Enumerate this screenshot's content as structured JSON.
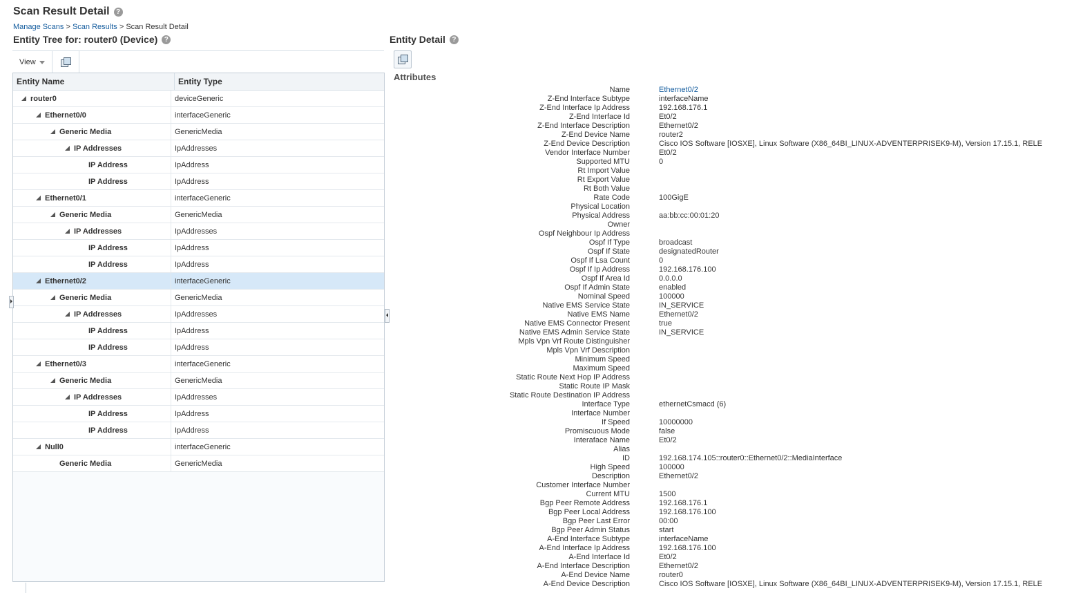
{
  "page": {
    "title": "Scan Result Detail",
    "help_glyph": "?"
  },
  "breadcrumb": {
    "items": [
      "Manage Scans",
      "Scan Results"
    ],
    "separator": ">",
    "current": "Scan Result Detail"
  },
  "entity_tree": {
    "title": "Entity Tree for: router0 (Device)",
    "view_menu": "View",
    "columns": {
      "name": "Entity Name",
      "type": "Entity Type"
    },
    "rows": [
      {
        "name": "router0",
        "type": "deviceGeneric",
        "depth": 0,
        "expanded": true,
        "selected": false
      },
      {
        "name": "Ethernet0/0",
        "type": "interfaceGeneric",
        "depth": 1,
        "expanded": true,
        "selected": false
      },
      {
        "name": "Generic Media",
        "type": "GenericMedia",
        "depth": 2,
        "expanded": true,
        "selected": false
      },
      {
        "name": "IP Addresses",
        "type": "IpAddresses",
        "depth": 3,
        "expanded": true,
        "selected": false
      },
      {
        "name": "IP Address",
        "type": "IpAddress",
        "depth": 4,
        "expanded": false,
        "selected": false
      },
      {
        "name": "IP Address",
        "type": "IpAddress",
        "depth": 4,
        "expanded": false,
        "selected": false
      },
      {
        "name": "Ethernet0/1",
        "type": "interfaceGeneric",
        "depth": 1,
        "expanded": true,
        "selected": false
      },
      {
        "name": "Generic Media",
        "type": "GenericMedia",
        "depth": 2,
        "expanded": true,
        "selected": false
      },
      {
        "name": "IP Addresses",
        "type": "IpAddresses",
        "depth": 3,
        "expanded": true,
        "selected": false
      },
      {
        "name": "IP Address",
        "type": "IpAddress",
        "depth": 4,
        "expanded": false,
        "selected": false
      },
      {
        "name": "IP Address",
        "type": "IpAddress",
        "depth": 4,
        "expanded": false,
        "selected": false
      },
      {
        "name": "Ethernet0/2",
        "type": "interfaceGeneric",
        "depth": 1,
        "expanded": true,
        "selected": true
      },
      {
        "name": "Generic Media",
        "type": "GenericMedia",
        "depth": 2,
        "expanded": true,
        "selected": false
      },
      {
        "name": "IP Addresses",
        "type": "IpAddresses",
        "depth": 3,
        "expanded": true,
        "selected": false
      },
      {
        "name": "IP Address",
        "type": "IpAddress",
        "depth": 4,
        "expanded": false,
        "selected": false
      },
      {
        "name": "IP Address",
        "type": "IpAddress",
        "depth": 4,
        "expanded": false,
        "selected": false
      },
      {
        "name": "Ethernet0/3",
        "type": "interfaceGeneric",
        "depth": 1,
        "expanded": true,
        "selected": false
      },
      {
        "name": "Generic Media",
        "type": "GenericMedia",
        "depth": 2,
        "expanded": true,
        "selected": false
      },
      {
        "name": "IP Addresses",
        "type": "IpAddresses",
        "depth": 3,
        "expanded": true,
        "selected": false
      },
      {
        "name": "IP Address",
        "type": "IpAddress",
        "depth": 4,
        "expanded": false,
        "selected": false
      },
      {
        "name": "IP Address",
        "type": "IpAddress",
        "depth": 4,
        "expanded": false,
        "selected": false
      },
      {
        "name": "Null0",
        "type": "interfaceGeneric",
        "depth": 1,
        "expanded": true,
        "selected": false
      },
      {
        "name": "Generic Media",
        "type": "GenericMedia",
        "depth": 2,
        "expanded": false,
        "selected": false
      }
    ]
  },
  "entity_detail": {
    "title": "Entity Detail",
    "section_heading": "Attributes",
    "attributes": [
      {
        "label": "Name",
        "value": "Ethernet0/2",
        "link": true
      },
      {
        "label": "Z-End Interface Subtype",
        "value": "interfaceName"
      },
      {
        "label": "Z-End Interface Ip Address",
        "value": "192.168.176.1"
      },
      {
        "label": "Z-End Interface Id",
        "value": "Et0/2"
      },
      {
        "label": "Z-End Interface Description",
        "value": "Ethernet0/2"
      },
      {
        "label": "Z-End Device Name",
        "value": "router2"
      },
      {
        "label": "Z-End Device Description",
        "value": "Cisco IOS Software [IOSXE], Linux Software (X86_64BI_LINUX-ADVENTERPRISEK9-M), Version 17.15.1, RELE"
      },
      {
        "label": "Vendor Interface Number",
        "value": "Et0/2"
      },
      {
        "label": "Supported MTU",
        "value": "0"
      },
      {
        "label": "Rt Import Value",
        "value": ""
      },
      {
        "label": "Rt Export Value",
        "value": ""
      },
      {
        "label": "Rt Both Value",
        "value": ""
      },
      {
        "label": "Rate Code",
        "value": "100GigE"
      },
      {
        "label": "Physical Location",
        "value": ""
      },
      {
        "label": "Physical Address",
        "value": "aa:bb:cc:00:01:20"
      },
      {
        "label": "Owner",
        "value": ""
      },
      {
        "label": "Ospf Neighbour Ip Address",
        "value": ""
      },
      {
        "label": "Ospf If Type",
        "value": "broadcast"
      },
      {
        "label": "Ospf If State",
        "value": "designatedRouter"
      },
      {
        "label": "Ospf If Lsa Count",
        "value": "0"
      },
      {
        "label": "Ospf If Ip Address",
        "value": "192.168.176.100"
      },
      {
        "label": "Ospf If Area Id",
        "value": "0.0.0.0"
      },
      {
        "label": "Ospf If Admin State",
        "value": "enabled"
      },
      {
        "label": "Nominal Speed",
        "value": "100000"
      },
      {
        "label": "Native EMS Service State",
        "value": "IN_SERVICE"
      },
      {
        "label": "Native EMS Name",
        "value": "Ethernet0/2"
      },
      {
        "label": "Native EMS Connector Present",
        "value": "true"
      },
      {
        "label": "Native EMS Admin Service State",
        "value": "IN_SERVICE"
      },
      {
        "label": "Mpls Vpn Vrf Route Distinguisher",
        "value": ""
      },
      {
        "label": "Mpls Vpn Vrf Description",
        "value": ""
      },
      {
        "label": "Minimum Speed",
        "value": ""
      },
      {
        "label": "Maximum Speed",
        "value": ""
      },
      {
        "label": "Static Route Next Hop IP Address",
        "value": ""
      },
      {
        "label": "Static Route IP Mask",
        "value": ""
      },
      {
        "label": "Static Route Destination IP Address",
        "value": ""
      },
      {
        "label": "Interface Type",
        "value": "ethernetCsmacd (6)"
      },
      {
        "label": "Interface Number",
        "value": ""
      },
      {
        "label": "If Speed",
        "value": "10000000"
      },
      {
        "label": "Promiscuous Mode",
        "value": "false"
      },
      {
        "label": "Interaface Name",
        "value": "Et0/2"
      },
      {
        "label": "Alias",
        "value": ""
      },
      {
        "label": "ID",
        "value": "192.168.174.105::router0::Ethernet0/2::MediaInterface"
      },
      {
        "label": "High Speed",
        "value": "100000"
      },
      {
        "label": "Description",
        "value": "Ethernet0/2"
      },
      {
        "label": "Customer Interface Number",
        "value": ""
      },
      {
        "label": "Current MTU",
        "value": "1500"
      },
      {
        "label": "Bgp Peer Remote Address",
        "value": "192.168.176.1"
      },
      {
        "label": "Bgp Peer Local Address",
        "value": "192.168.176.100"
      },
      {
        "label": "Bgp Peer Last Error",
        "value": "00:00"
      },
      {
        "label": "Bgp Peer Admin Status",
        "value": "start"
      },
      {
        "label": "A-End Interface Subtype",
        "value": "interfaceName"
      },
      {
        "label": "A-End Interface Ip Address",
        "value": "192.168.176.100"
      },
      {
        "label": "A-End Interface Id",
        "value": "Et0/2"
      },
      {
        "label": "A-End Interface Description",
        "value": "Ethernet0/2"
      },
      {
        "label": "A-End Device Name",
        "value": "router0"
      },
      {
        "label": "A-End Device Description",
        "value": "Cisco IOS Software [IOSXE], Linux Software (X86_64BI_LINUX-ADVENTERPRISEK9-M), Version 17.15.1, RELE"
      }
    ]
  }
}
